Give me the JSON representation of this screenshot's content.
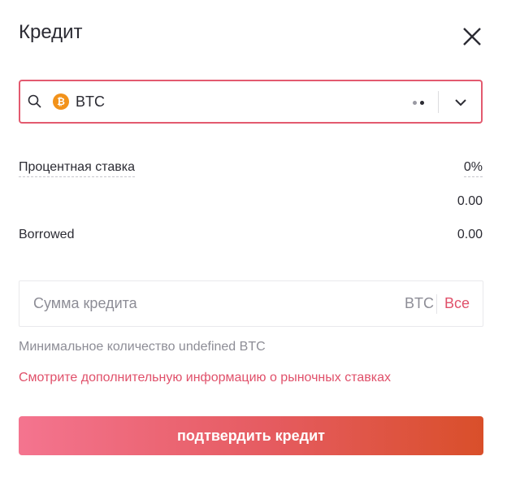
{
  "dialog": {
    "title": "Кредит"
  },
  "asset_select": {
    "selected_symbol": "BTC",
    "coin_glyph": "₿",
    "coin_color": "#f2921a",
    "border_color": "#e35a6f",
    "icons": [
      "search-icon",
      "bitcoin-icon",
      "loading-dots",
      "chevron-down-icon"
    ]
  },
  "info": {
    "interest_label": "Процентная ставка",
    "interest_value": "0%",
    "available_value": "0.00",
    "borrowed_label": "Borrowed",
    "borrowed_value": "0.00"
  },
  "amount_field": {
    "placeholder": "Сумма кредита",
    "unit": "BTC",
    "all_label": "Все"
  },
  "min_text": "Минимальное количество undefined BTC",
  "market_rates_link": "Смотрите дополнительную информацию о рыночных ставках",
  "confirm_button": "подтвердить кредит",
  "colors": {
    "accent": "#e0506a",
    "button_gradient": [
      "#f4748f",
      "#e55b5f",
      "#d94f2a"
    ]
  }
}
